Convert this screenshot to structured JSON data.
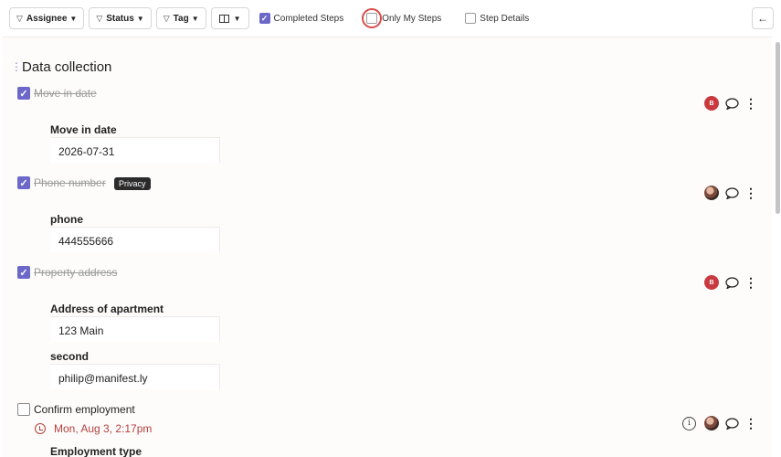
{
  "toolbar": {
    "assignee_label": "Assignee",
    "status_label": "Status",
    "tag_label": "Tag",
    "completed_steps_label": "Completed Steps",
    "completed_steps_checked": true,
    "only_my_steps_label": "Only My Steps",
    "only_my_steps_checked": false,
    "step_details_label": "Step Details",
    "step_details_checked": false
  },
  "icons": {
    "filter": "filter-icon",
    "columns": "columns-icon",
    "back": "back-arrow-icon",
    "comment": "comment-icon",
    "more": "kebab-menu-icon",
    "info": "info-icon",
    "clock": "clock-icon"
  },
  "colors": {
    "accent": "#6b68c9",
    "avatar_red": "#c93a40",
    "overdue": "#b4403c",
    "focus_ring": "#d94b4b"
  },
  "section": {
    "title": "Data collection"
  },
  "steps": [
    {
      "title": "Move in date",
      "completed": true,
      "avatar_initial": "B",
      "fields": [
        {
          "label": "Move in date",
          "value": "2026-07-31"
        }
      ]
    },
    {
      "title": "Phone number",
      "completed": true,
      "badge": "Privacy",
      "avatar": "photo",
      "fields": [
        {
          "label": "phone",
          "value": "444555666"
        }
      ]
    },
    {
      "title": "Property address",
      "completed": true,
      "avatar_initial": "B",
      "fields": [
        {
          "label": "Address of apartment",
          "value": "123 Main"
        },
        {
          "label": "second",
          "value": "philip@manifest.ly"
        }
      ]
    },
    {
      "title": "Confirm employment",
      "completed": false,
      "due": "Mon, Aug 3, 2:17pm",
      "avatar": "photo",
      "next_field_label": "Employment type"
    }
  ]
}
